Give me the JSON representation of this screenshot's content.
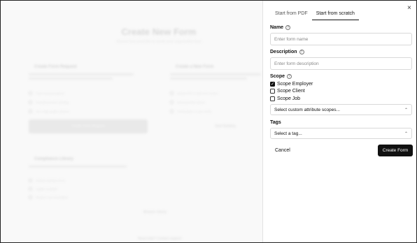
{
  "background": {
    "title": "Create New Form",
    "subtitle": "Choose how you'd like to create your organization form",
    "card_request_title": "Create Form Request",
    "card_new_title": "Create a New Form",
    "request_items": [
      "Track request progress",
      "Professional form handling",
      "Get a high-quality outcome"
    ],
    "new_items": [
      "Upload PDF or start from scratch",
      "Advanced field options",
      "Full template on your needs"
    ],
    "request_button": "Create Form Request",
    "new_link": "Start Building",
    "compliance_title": "Compliance Library",
    "compliance_items": [
      "Industry standard forms",
      "Legally compliant",
      "Ready to use immediately"
    ],
    "browse_link": "Browse Library",
    "footer_link": "Need help? Contact support"
  },
  "panel": {
    "close_label": "×",
    "tabs": [
      "Start from PDF",
      "Start from scratch"
    ],
    "active_tab": 1,
    "name_label": "Name",
    "name_placeholder": "Enter form name",
    "description_label": "Description",
    "description_placeholder": "Enter form description",
    "scope_label": "Scope",
    "scope_options": [
      {
        "label": "Scope Employer",
        "checked": true
      },
      {
        "label": "Scope Client",
        "checked": false
      },
      {
        "label": "Scope Job",
        "checked": false
      }
    ],
    "custom_scopes_placeholder": "Select custom attribute scopes...",
    "tags_label": "Tags",
    "tags_placeholder": "Select a tag...",
    "cancel_label": "Cancel",
    "create_label": "Create Form",
    "help_glyph": "?",
    "chevron_glyph": "⌃⌄",
    "check_glyph": "✓"
  }
}
